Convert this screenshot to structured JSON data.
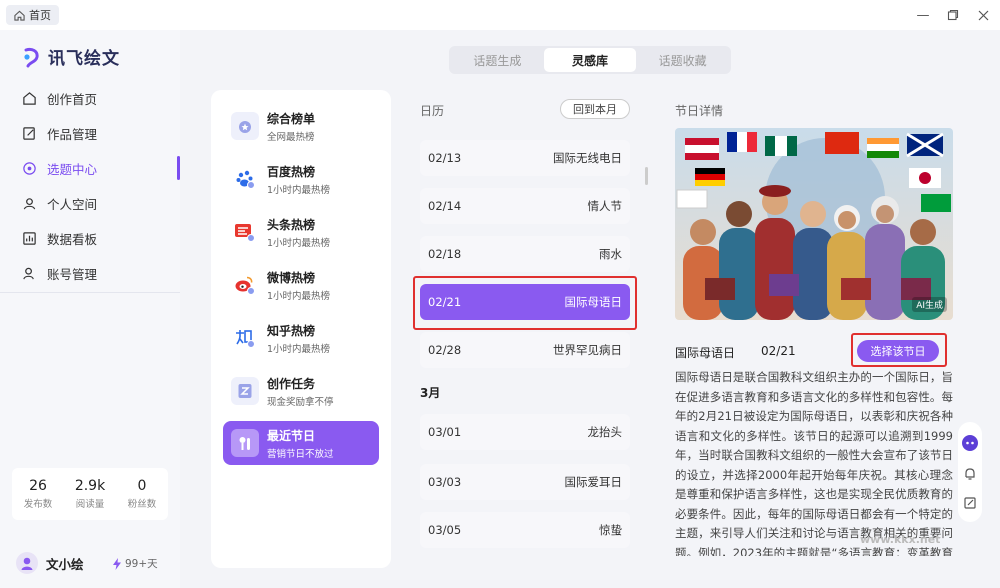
{
  "topbar": {
    "home_tab": "首页"
  },
  "sidebar": {
    "logo": "讯飞绘文",
    "nav": [
      {
        "label": "创作首页",
        "icon": "home-icon"
      },
      {
        "label": "作品管理",
        "icon": "edit-icon"
      },
      {
        "label": "选题中心",
        "icon": "target-icon",
        "active": true
      },
      {
        "label": "个人空间",
        "icon": "person-icon"
      },
      {
        "label": "数据看板",
        "icon": "chart-icon"
      },
      {
        "label": "账号管理",
        "icon": "account-icon"
      }
    ],
    "stats": [
      {
        "value": "26",
        "label": "发布数"
      },
      {
        "value": "2.9k",
        "label": "阅读量"
      },
      {
        "value": "0",
        "label": "粉丝数"
      }
    ],
    "user": {
      "name": "文小绘",
      "vip": "99+天"
    }
  },
  "main": {
    "tabs": [
      {
        "label": "话题生成"
      },
      {
        "label": "灵感库",
        "active": true
      },
      {
        "label": "话题收藏"
      }
    ],
    "ranks": [
      {
        "title": "综合榜单",
        "sub": "全网最热榜"
      },
      {
        "title": "百度热榜",
        "sub": "1小时内最热榜"
      },
      {
        "title": "头条热榜",
        "sub": "1小时内最热榜"
      },
      {
        "title": "微博热榜",
        "sub": "1小时内最热榜"
      },
      {
        "title": "知乎热榜",
        "sub": "1小时内最热榜"
      },
      {
        "title": "创作任务",
        "sub": "现金奖励拿不停"
      },
      {
        "title": "最近节日",
        "sub": "营销节日不放过",
        "active": true
      }
    ],
    "calendar": {
      "label": "日历",
      "back_button": "回到本月",
      "days": [
        {
          "date": "02/13",
          "name": "国际无线电日"
        },
        {
          "date": "02/14",
          "name": "情人节"
        },
        {
          "date": "02/18",
          "name": "雨水"
        },
        {
          "date": "02/21",
          "name": "国际母语日",
          "selected": true
        },
        {
          "date": "02/28",
          "name": "世界罕见病日"
        }
      ],
      "month_header": "3月",
      "days2": [
        {
          "date": "03/01",
          "name": "龙抬头"
        },
        {
          "date": "03/03",
          "name": "国际爱耳日"
        },
        {
          "date": "03/05",
          "name": "惊蛰"
        }
      ]
    },
    "detail": {
      "label": "节日详情",
      "ai_tag": "AI生成",
      "name": "国际母语日",
      "date": "02/21",
      "choose_button": "选择该节日",
      "text": "国际母语日是联合国教科文组织主办的一个国际日，旨在促进多语言教育和多语言文化的多样性和包容性。每年的2月21日被设定为国际母语日，以表彰和庆祝各种语言和文化的多样性。该节日的起源可以追溯到1999年，当时联合国教科文组织的一般性大会宣布了该节日的设立，并选择2000年起开始每年庆祝。其核心理念是尊重和保护语言多样性，这也是实现全民优质教育的必要条件。因此，每年的国际母语日都会有一个特定的主题，来引导人们关注和讨论与语言教育相关的重要问题。例如，2023年的主题就是“多语言教育：变革教育的必要条件”，它关注的重如"
    },
    "colors": {
      "accent": "#8a5af0",
      "highlight_box": "#e0302f"
    }
  },
  "watermark": "www.kkx.net"
}
